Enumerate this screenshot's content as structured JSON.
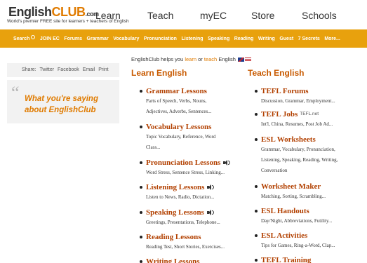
{
  "header": {
    "logo": {
      "part1": "English",
      "part2": "CLUB",
      "part3": ".com"
    },
    "tagline": "World's premier FREE site for learners + teachers of English",
    "nav": [
      "Learn",
      "Teach",
      "myEC",
      "Store",
      "Schools"
    ]
  },
  "orange_nav": [
    "Search",
    "JOIN EC",
    "Forums",
    "Grammar",
    "Vocabulary",
    "Pronunciation",
    "Listening",
    "Speaking",
    "Reading",
    "Writing",
    "Guest",
    "7 Secrets",
    "More..."
  ],
  "share": {
    "label": "Share:",
    "links": [
      "Twitter",
      "Facebook",
      "Email",
      "Print"
    ]
  },
  "quote": {
    "mark": "“",
    "text": "What you're saying about EnglishClub"
  },
  "helps": {
    "prefix": "EnglishClub helps you",
    "learn": "learn",
    "or": "or",
    "teach": "teach",
    "suffix": "English"
  },
  "learn": {
    "title": "Learn English",
    "items": [
      {
        "title": "Grammar Lessons",
        "sub": [
          "Parts of Speech, Verbs, Nouns,",
          "Adjectives, Adverbs, Sentences..."
        ],
        "audio": false
      },
      {
        "title": "Vocabulary Lessons",
        "sub": [
          "Topic Vocabulary, Reference, Word",
          "Class..."
        ],
        "audio": false
      },
      {
        "title": "Pronunciation Lessons",
        "sub": [
          "Word Stress, Sentence Stress, Linking..."
        ],
        "audio": true
      },
      {
        "title": "Listening Lessons",
        "sub": [
          "Listen to News, Radio, Dictation..."
        ],
        "audio": true
      },
      {
        "title": "Speaking Lessons",
        "sub": [
          "Greetings, Presentations, Telephone..."
        ],
        "audio": true
      },
      {
        "title": "Reading Lessons",
        "sub": [
          "Reading Test, Short Stories, Exercises..."
        ],
        "audio": false
      },
      {
        "title": "Writing Lessons",
        "sub": [],
        "audio": false
      }
    ]
  },
  "teach": {
    "title": "Teach English",
    "items": [
      {
        "title": "TEFL Forums",
        "extra": "",
        "sub": [
          "Discussion, Grammar, Employment..."
        ]
      },
      {
        "title": "TEFL Jobs",
        "extra": "TEFL.net",
        "sub": [
          "Int'l, China, Resumes, Post Job Ad..."
        ]
      },
      {
        "title": "ESL Worksheets",
        "extra": "",
        "sub": [
          "Grammar, Vocabulary, Pronunciation,",
          "Listening, Speaking, Reading, Writing,",
          "Conversation"
        ]
      },
      {
        "title": "Worksheet Maker",
        "extra": "",
        "sub": [
          "Matching, Sorting, Scrambling..."
        ]
      },
      {
        "title": "ESL Handouts",
        "extra": "",
        "sub": [
          "Day/Night, Abbreviations, Futility..."
        ]
      },
      {
        "title": "ESL Activities",
        "extra": "",
        "sub": [
          "Tips for Games, Ring-a-Word, Clap..."
        ]
      },
      {
        "title": "TEFL Training",
        "extra": "",
        "sub": []
      }
    ]
  }
}
